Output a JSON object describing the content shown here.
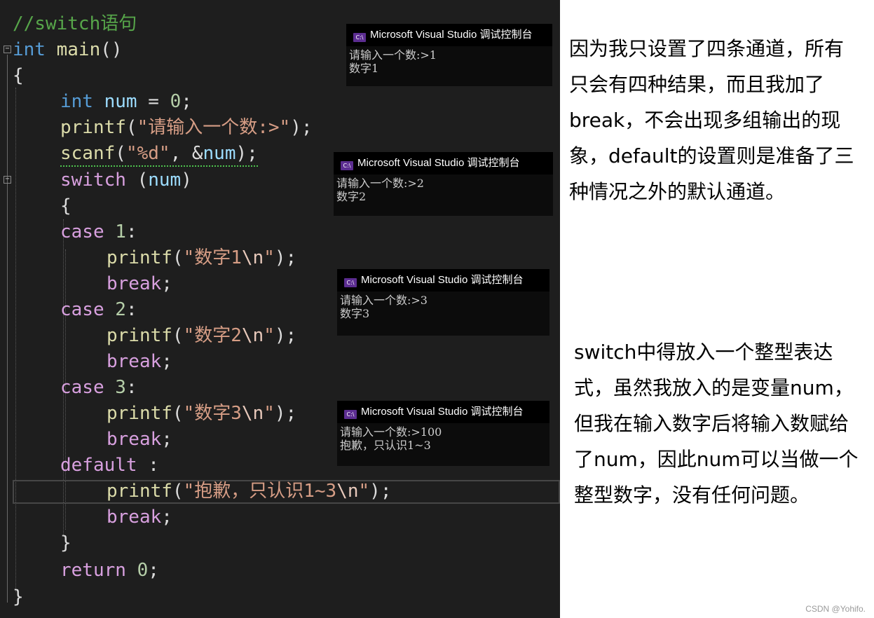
{
  "editor": {
    "comment": "//switch语句",
    "fold_minus": "⊟",
    "tokens": {
      "int": "int",
      "main": "main",
      "parens": "()",
      "open_brace": "{",
      "close_brace": "}",
      "num": "num",
      "eq": " = ",
      "zero": "0",
      "semicolon": ";",
      "printf": "printf",
      "scanf": "scanf",
      "lparen": "(",
      "rparen": ")",
      "rparen_semi": ");",
      "prompt_str": "\"请输入一个数:>\"",
      "fmt_str": "\"%d\"",
      "comma_amp": ", &",
      "switch": "switch",
      "case": "case",
      "colon": ":",
      "one": "1",
      "two": "2",
      "three": "3",
      "str1_open": "\"数字1",
      "str2_open": "\"数字2",
      "str3_open": "\"数字3",
      "str4_open": "\"抱歉，只认识1~3",
      "esc_n": "\\n",
      "quote": "\"",
      "break": "break",
      "default": "default",
      "default_colon": " :",
      "return": "return"
    }
  },
  "consoles": [
    {
      "title": "Microsoft Visual Studio 调试控制台",
      "lines": "请输入一个数:>1\n数字1"
    },
    {
      "title": "Microsoft Visual Studio 调试控制台",
      "lines": "请输入一个数:>2\n数字2"
    },
    {
      "title": "Microsoft Visual Studio 调试控制台",
      "lines": "请输入一个数:>3\n数字3"
    },
    {
      "title": "Microsoft Visual Studio 调试控制台",
      "lines": "请输入一个数:>100\n抱歉，只认识1~3"
    }
  ],
  "console_icon": "C:\\",
  "notes": {
    "top": [
      "因为我只设置了四条通道，所有",
      "只会有四种结果，而且我加了",
      "break，不会出现多组输出的现",
      "象，default的设置则是准备了三",
      "种情况之外的默认通道。"
    ],
    "bottom": [
      "switch中得放入一个整型表达",
      "式，虽然我放入的是变量num，",
      "但我在输入数字后将输入数赋给",
      "了num，因此num可以当做一个",
      "整型数字，没有任何问题。"
    ]
  },
  "watermark": "CSDN @Yohifo."
}
